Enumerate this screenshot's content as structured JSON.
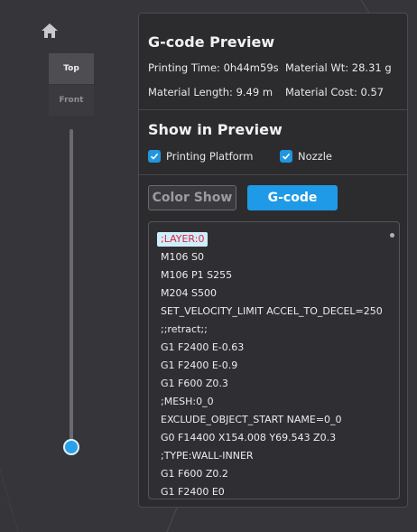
{
  "view": {
    "top_label": "Top",
    "front_label": "Front"
  },
  "panel": {
    "title": "G-code Preview",
    "stats": {
      "printing_time": "Printing Time: 0h44m59s",
      "material_wt": "Material Wt: 28.31 g",
      "material_length": "Material Length: 9.49 m",
      "material_cost": "Material Cost: 0.57"
    },
    "show_title": "Show in Preview",
    "printing_platform": {
      "label": "Printing Platform",
      "checked": true
    },
    "nozzle": {
      "label": "Nozzle",
      "checked": true
    },
    "color_show_label": "Color Show",
    "gcode_label": "G-code",
    "gcode_lines": [
      ";LAYER:0",
      "M106 S0",
      "M106 P1 S255",
      "M204 S500",
      "SET_VELOCITY_LIMIT ACCEL_TO_DECEL=250",
      ";;retract;;",
      "G1 F2400 E-0.63",
      "G1 F2400 E-0.9",
      "G1 F600 Z0.3",
      ";MESH:0_0",
      "EXCLUDE_OBJECT_START NAME=0_0",
      "G0 F14400 X154.008 Y69.543 Z0.3",
      ";TYPE:WALL-INNER",
      "G1 F600 Z0.2",
      "G1 F2400 E0"
    ]
  },
  "colors": {
    "accent": "#1f9ae6",
    "highlight_bg": "#cfeefc",
    "highlight_text": "#e0243c"
  }
}
